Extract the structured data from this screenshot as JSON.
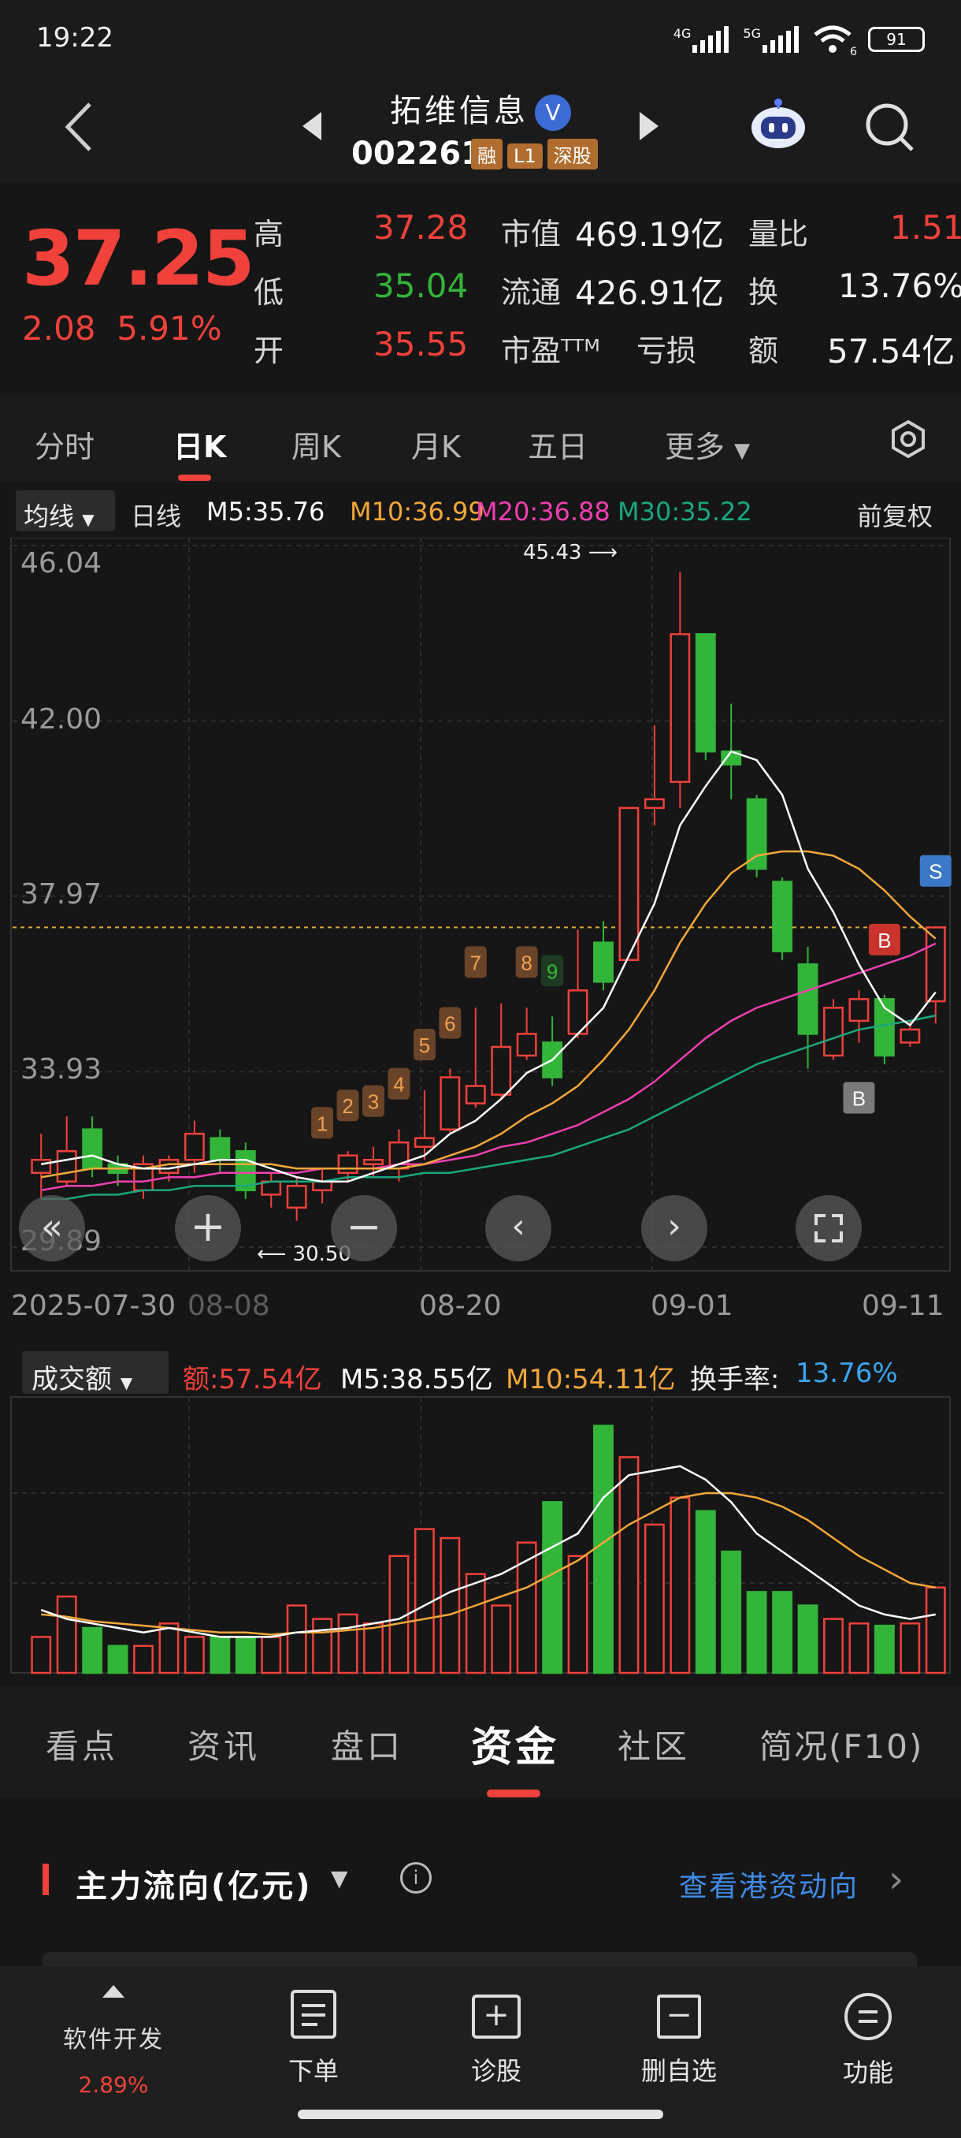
{
  "status": {
    "time": "19:22",
    "battery": "91",
    "net1": "4G",
    "net2": "5G",
    "wifi_sub": "6"
  },
  "header": {
    "name": "拓维信息",
    "verified": "V",
    "code": "002261",
    "tags": [
      "融",
      "L1",
      "深股"
    ]
  },
  "quote": {
    "price": "37.25",
    "change": "2.08",
    "change_pct": "5.91%",
    "rows": [
      {
        "l1": "高",
        "v1": "37.28",
        "l2": "市值",
        "v2": "469.19亿",
        "l3": "量比",
        "v3": "1.51"
      },
      {
        "l1": "低",
        "v1": "35.04",
        "l2": "流通",
        "v2": "426.91亿",
        "l3": "换",
        "v3": "13.76%"
      },
      {
        "l1": "开",
        "v1": "35.55",
        "l2": "市盈ᵀᵀᴹ",
        "v2": "亏损",
        "l3": "额",
        "v3": "57.54亿"
      }
    ],
    "colors": {
      "up": "#f0413b",
      "down": "#33b539"
    }
  },
  "period_tabs": [
    "分时",
    "日K",
    "周K",
    "月K",
    "五日",
    "更多"
  ],
  "ma_row": {
    "selector": "均线",
    "period": "日线",
    "m5": "M5:35.76",
    "m10": "M10:36.99",
    "m20": "M20:36.88",
    "m30": "M30:35.22",
    "adjust": "前复权"
  },
  "chart_data": {
    "type": "candlestick",
    "y_ticks": [
      "46.04",
      "42.00",
      "37.97",
      "33.93",
      "29.89"
    ],
    "ylim": [
      29.89,
      46.04
    ],
    "x_tick_labels": [
      "2025-07-30",
      "08-08",
      "08-20",
      "09-01",
      "09-11"
    ],
    "high_label": "45.43",
    "low_label": "30.50",
    "current_line": 37.25,
    "candles": [
      [
        31.6,
        31.9,
        31.0,
        32.5
      ],
      [
        31.4,
        32.1,
        31.3,
        32.9
      ],
      [
        32.6,
        31.7,
        31.5,
        32.9
      ],
      [
        31.8,
        31.6,
        31.3,
        32.0
      ],
      [
        31.2,
        31.8,
        31.0,
        32.0
      ],
      [
        31.6,
        31.9,
        31.4,
        32.0
      ],
      [
        31.9,
        32.5,
        31.6,
        32.8
      ],
      [
        32.4,
        31.9,
        31.6,
        32.6
      ],
      [
        32.1,
        31.2,
        31.0,
        32.3
      ],
      [
        31.1,
        31.4,
        30.8,
        31.6
      ],
      [
        30.8,
        31.3,
        30.5,
        31.5
      ],
      [
        31.2,
        31.4,
        30.9,
        31.7
      ],
      [
        31.6,
        32.0,
        31.4,
        32.1
      ],
      [
        31.8,
        31.9,
        31.5,
        32.2
      ],
      [
        31.7,
        32.3,
        31.4,
        32.6
      ],
      [
        32.2,
        32.4,
        31.9,
        33.5
      ],
      [
        32.6,
        33.8,
        32.5,
        34.0
      ],
      [
        33.2,
        33.6,
        33.1,
        35.4
      ],
      [
        33.4,
        34.5,
        33.3,
        35.5
      ],
      [
        34.3,
        34.8,
        34.2,
        35.4
      ],
      [
        34.6,
        33.8,
        33.6,
        35.2
      ],
      [
        34.8,
        35.8,
        34.7,
        37.2
      ],
      [
        36.9,
        36.0,
        35.8,
        37.4
      ],
      [
        36.5,
        40.0,
        36.5,
        40.0
      ],
      [
        40.0,
        40.2,
        39.6,
        41.9
      ],
      [
        40.6,
        44.0,
        40.0,
        45.43
      ],
      [
        44.0,
        41.3,
        41.1,
        44.0
      ],
      [
        41.3,
        41.0,
        40.2,
        42.4
      ],
      [
        40.2,
        38.6,
        38.4,
        40.3
      ],
      [
        38.3,
        36.7,
        36.5,
        38.4
      ],
      [
        36.4,
        34.8,
        34.0,
        36.8
      ],
      [
        34.3,
        35.4,
        34.2,
        35.6
      ],
      [
        35.1,
        35.6,
        34.6,
        35.8
      ],
      [
        35.6,
        34.3,
        34.1,
        35.7
      ],
      [
        34.6,
        34.9,
        34.5,
        35.1
      ],
      [
        35.55,
        37.25,
        35.04,
        37.28
      ]
    ],
    "ma5": [
      31.8,
      31.9,
      32.0,
      31.8,
      31.7,
      31.7,
      31.8,
      31.9,
      31.9,
      31.7,
      31.5,
      31.4,
      31.4,
      31.6,
      31.8,
      32.0,
      32.5,
      32.8,
      33.3,
      33.9,
      34.2,
      34.8,
      35.4,
      36.6,
      37.8,
      39.6,
      40.5,
      41.3,
      41.1,
      40.3,
      38.6,
      37.6,
      36.4,
      35.4,
      35.0,
      35.76
    ],
    "ma10": [
      31.5,
      31.6,
      31.7,
      31.7,
      31.7,
      31.8,
      31.8,
      31.8,
      31.8,
      31.8,
      31.7,
      31.7,
      31.7,
      31.7,
      31.7,
      31.8,
      32.0,
      32.2,
      32.5,
      32.9,
      33.2,
      33.6,
      34.2,
      34.9,
      35.8,
      36.9,
      37.8,
      38.5,
      38.9,
      39.0,
      39.0,
      38.9,
      38.6,
      38.1,
      37.5,
      36.99
    ],
    "ma20": [
      31.2,
      31.3,
      31.3,
      31.4,
      31.4,
      31.5,
      31.5,
      31.6,
      31.6,
      31.6,
      31.6,
      31.7,
      31.7,
      31.7,
      31.8,
      31.8,
      31.9,
      32.0,
      32.2,
      32.3,
      32.5,
      32.7,
      33.0,
      33.3,
      33.7,
      34.2,
      34.7,
      35.1,
      35.4,
      35.6,
      35.8,
      36.0,
      36.2,
      36.4,
      36.6,
      36.88
    ],
    "ma30": [
      31.0,
      31.0,
      31.1,
      31.1,
      31.2,
      31.2,
      31.3,
      31.3,
      31.3,
      31.4,
      31.4,
      31.4,
      31.5,
      31.5,
      31.5,
      31.6,
      31.6,
      31.7,
      31.8,
      31.9,
      32.0,
      32.2,
      32.4,
      32.6,
      32.9,
      33.2,
      33.5,
      33.8,
      34.1,
      34.3,
      34.5,
      34.7,
      34.9,
      35.0,
      35.1,
      35.22
    ],
    "signals": [
      {
        "i": 11,
        "text": "1"
      },
      {
        "i": 12,
        "text": "2"
      },
      {
        "i": 13,
        "text": "3"
      },
      {
        "i": 14,
        "text": "4"
      },
      {
        "i": 15,
        "text": "5"
      },
      {
        "i": 16,
        "text": "6"
      },
      {
        "i": 17,
        "text": "7"
      },
      {
        "i": 19,
        "text": "8"
      },
      {
        "i": 20,
        "text": "9"
      }
    ],
    "trade_marks": [
      {
        "i": 33,
        "text": "B",
        "color": "#c8332c"
      },
      {
        "i": 32,
        "text": "B",
        "color": "#7a7a7a"
      },
      {
        "i": 35,
        "text": "S",
        "color": "#3c78c8"
      }
    ]
  },
  "controls": [
    "collapse-icon",
    "zoom-in-icon",
    "zoom-out-icon",
    "pan-left-icon",
    "pan-right-icon",
    "fullscreen-icon"
  ],
  "volume": {
    "selector": "成交额",
    "amount": "额:57.54亿",
    "m5": "M5:38.55亿",
    "m10": "M10:54.11亿",
    "turnover_label": "换手率:",
    "turnover": "13.76%",
    "bars": [
      16,
      34,
      20,
      12,
      12,
      22,
      16,
      16,
      16,
      16,
      30,
      24,
      26,
      22,
      52,
      64,
      60,
      44,
      30,
      58,
      76,
      52,
      110,
      96,
      66,
      78,
      72,
      54,
      36,
      36,
      30,
      24,
      22,
      21,
      22,
      38
    ],
    "ma5": [
      28,
      24,
      22,
      20,
      18,
      20,
      18,
      16,
      16,
      16,
      18,
      19,
      20,
      22,
      24,
      30,
      36,
      40,
      44,
      50,
      56,
      62,
      78,
      88,
      90,
      92,
      86,
      76,
      62,
      54,
      46,
      38,
      30,
      26,
      24,
      26
    ],
    "ma10": [
      26,
      25,
      23,
      22,
      21,
      20,
      19,
      18,
      18,
      17,
      18,
      18,
      19,
      20,
      22,
      24,
      26,
      30,
      34,
      38,
      44,
      50,
      58,
      66,
      72,
      78,
      80,
      80,
      78,
      74,
      68,
      60,
      52,
      46,
      40,
      38
    ]
  },
  "bottom_tabs": [
    "看点",
    "资讯",
    "盘口",
    "资金",
    "社区",
    "简况(F10)"
  ],
  "flow": {
    "title": "主力流向(亿元)",
    "link": "查看港资动向"
  },
  "bottombar": {
    "stock_name": "软件开发",
    "stock_pct": "2.89%",
    "items": [
      "下单",
      "诊股",
      "删自选",
      "功能"
    ]
  }
}
